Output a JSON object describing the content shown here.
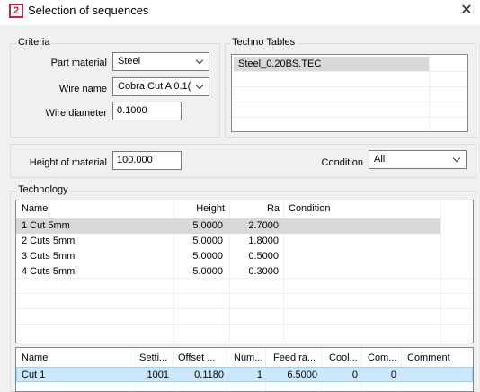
{
  "window": {
    "title": "Selection of sequences",
    "app_icon": "2",
    "close": "✕"
  },
  "criteria": {
    "title": "Criteria",
    "part_material_label": "Part material",
    "part_material_value": "Steel",
    "wire_name_label": "Wire name",
    "wire_name_value": "Cobra Cut A 0.1(",
    "wire_diameter_label": "Wire diameter",
    "wire_diameter_value": "0.1000"
  },
  "techno_tables": {
    "title": "Techno Tables",
    "items": [
      "Steel_0.20BS.TEC"
    ]
  },
  "height_row": {
    "height_label": "Height of material",
    "height_value": "100.000",
    "condition_label": "Condition",
    "condition_value": "All"
  },
  "technology": {
    "title": "Technology",
    "columns": [
      "Name",
      "Height",
      "Ra",
      "Condition"
    ],
    "rows": [
      {
        "name": "1 Cut 5mm",
        "height": "5.0000",
        "ra": "2.7000",
        "condition": ""
      },
      {
        "name": "2 Cuts 5mm",
        "height": "5.0000",
        "ra": "1.8000",
        "condition": ""
      },
      {
        "name": "3 Cuts 5mm",
        "height": "5.0000",
        "ra": "0.5000",
        "condition": ""
      },
      {
        "name": "4 Cuts 5mm",
        "height": "5.0000",
        "ra": "0.3000",
        "condition": ""
      }
    ],
    "selected_row": 0
  },
  "cuts": {
    "columns": [
      "Name",
      "Setti...",
      "Offset ...",
      "Num...",
      "Feed ra...",
      "Cool...",
      "Com...",
      "Comment"
    ],
    "rows": [
      {
        "name": "Cut 1",
        "setting": "1001",
        "offset": "0.1180",
        "num": "1",
        "feed_rate": "6.5000",
        "cool": "0",
        "com": "0",
        "comment": ""
      }
    ]
  },
  "colors": {
    "window_bg": "#f0f0f0",
    "selected_gray": "#d9d9d9",
    "selected_blue": "#cce8ff",
    "brand_red": "#c8243a"
  }
}
